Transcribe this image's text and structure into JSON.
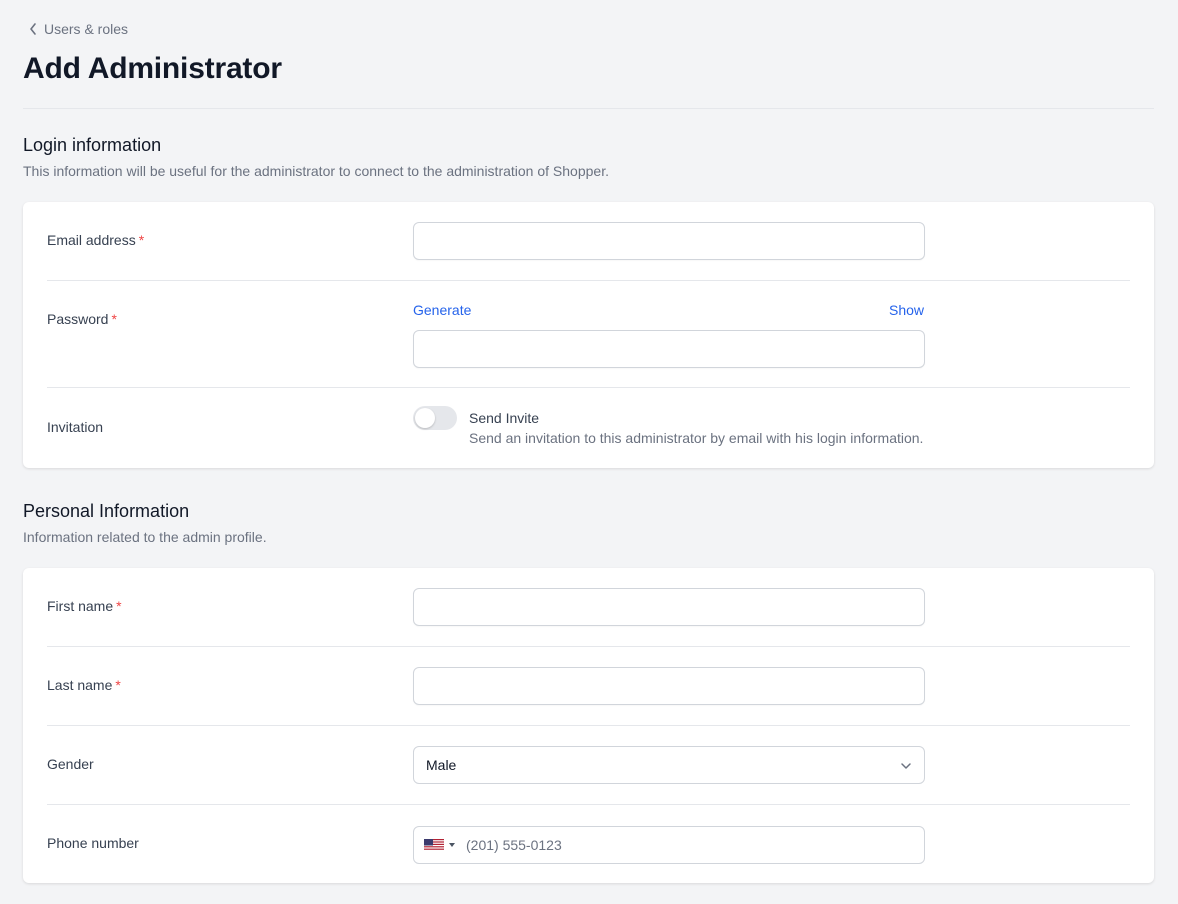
{
  "breadcrumb": {
    "label": "Users & roles"
  },
  "page": {
    "title": "Add Administrator"
  },
  "login_section": {
    "title": "Login information",
    "description": "This information will be useful for the administrator to connect to the administration of Shopper.",
    "email": {
      "label": "Email address",
      "required_mark": "*",
      "value": ""
    },
    "password": {
      "label": "Password",
      "required_mark": "*",
      "generate_label": "Generate",
      "show_label": "Show",
      "value": ""
    },
    "invitation": {
      "label": "Invitation",
      "toggle_title": "Send Invite",
      "toggle_description": "Send an invitation to this administrator by email with his login information.",
      "enabled": false
    }
  },
  "personal_section": {
    "title": "Personal Information",
    "description": "Information related to the admin profile.",
    "first_name": {
      "label": "First name",
      "required_mark": "*",
      "value": ""
    },
    "last_name": {
      "label": "Last name",
      "required_mark": "*",
      "value": ""
    },
    "gender": {
      "label": "Gender",
      "selected": "Male"
    },
    "phone": {
      "label": "Phone number",
      "placeholder": "(201) 555-0123",
      "country_flag": "us-flag-icon"
    }
  },
  "colors": {
    "accent": "#2563eb",
    "required": "#ef4444",
    "background": "#f3f4f6"
  }
}
